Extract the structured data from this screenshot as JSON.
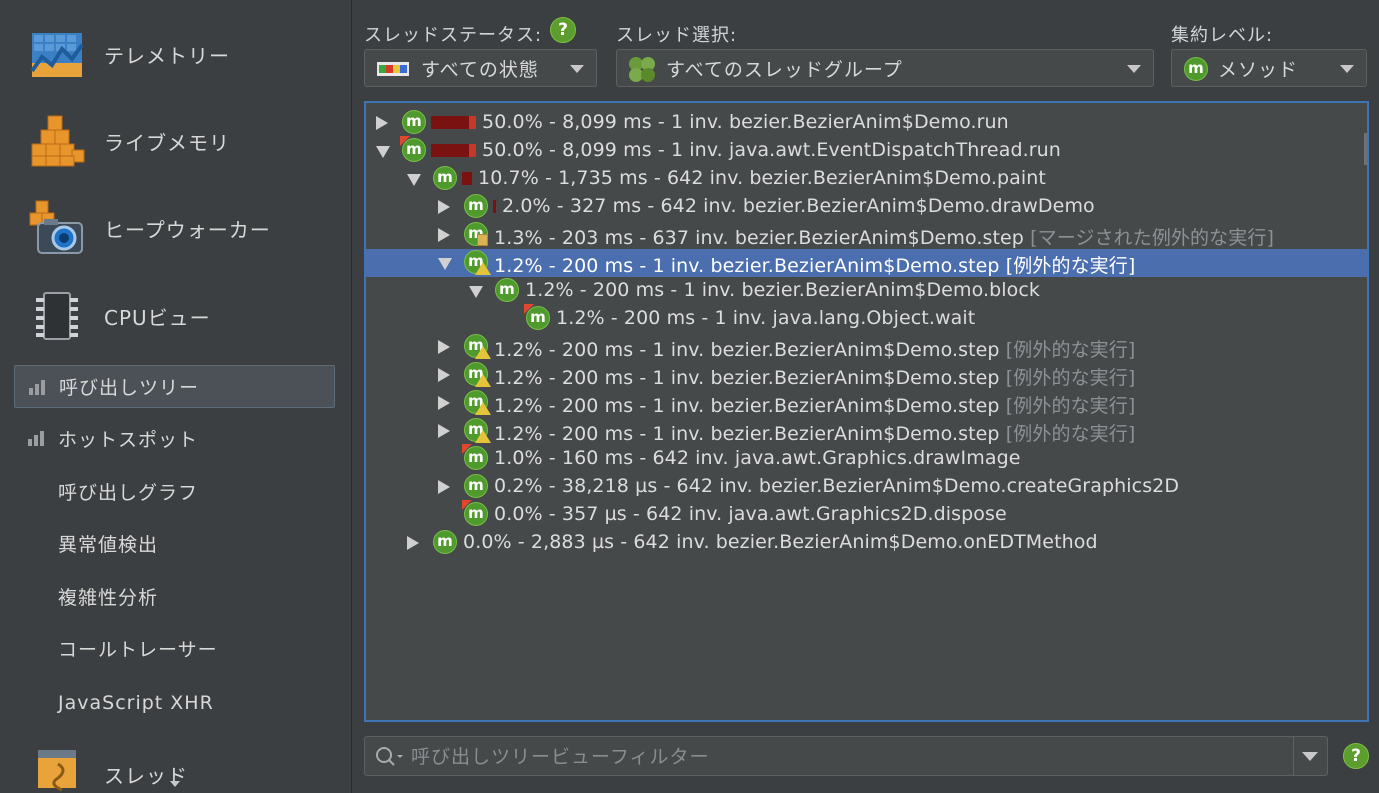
{
  "sidebar": {
    "big_items": [
      {
        "label": "テレメトリー",
        "icon": "telemetry-icon"
      },
      {
        "label": "ライブメモリ",
        "icon": "live-memory-icon"
      },
      {
        "label": "ヒープウォーカー",
        "icon": "heap-walker-icon"
      },
      {
        "label": "CPUビュー",
        "icon": "cpu-views-icon"
      }
    ],
    "sub_items": [
      {
        "label": "呼び出しツリー",
        "selected": true,
        "has_icon": true
      },
      {
        "label": "ホットスポット",
        "selected": false,
        "has_icon": true
      },
      {
        "label": "呼び出しグラフ",
        "selected": false,
        "has_icon": false
      },
      {
        "label": "異常値検出",
        "selected": false,
        "has_icon": false
      },
      {
        "label": "複雑性分析",
        "selected": false,
        "has_icon": false
      },
      {
        "label": "コールトレーサー",
        "selected": false,
        "has_icon": false
      },
      {
        "label": "JavaScript XHR",
        "selected": false,
        "has_icon": false
      }
    ],
    "partial_item": {
      "label": "スレッド",
      "icon": "threads-icon"
    }
  },
  "toolbar": {
    "thread_status_label": "スレッドステータス:",
    "thread_status_value": "すべての状態",
    "thread_select_label": "スレッド選択:",
    "thread_select_value": "すべてのスレッドグループ",
    "aggregation_label": "集約レベル:",
    "aggregation_value": "メソッド",
    "help_glyph": "?"
  },
  "tree": {
    "icon_letter": "m",
    "rows": [
      {
        "depth": 0,
        "toggle": "collapsed",
        "icon": "method",
        "badge": "none",
        "bar": [
          0.5,
          "#7a1212",
          "#c33a2b"
        ],
        "text": "50.0% - 8,099 ms - 1 inv. bezier.BezierAnim$Demo.run",
        "suffix": ""
      },
      {
        "depth": 0,
        "toggle": "expanded",
        "icon": "method",
        "badge": "corner",
        "bar": [
          0.5,
          "#7a1212",
          "#c33a2b"
        ],
        "text": "50.0% - 8,099 ms - 1 inv. java.awt.EventDispatchThread.run",
        "suffix": ""
      },
      {
        "depth": 1,
        "toggle": "expanded",
        "icon": "method",
        "badge": "none",
        "bar": [
          0.107,
          "#7a1212",
          "#7a1212"
        ],
        "text": "10.7% - 1,735 ms - 642 inv. bezier.BezierAnim$Demo.paint",
        "suffix": ""
      },
      {
        "depth": 2,
        "toggle": "collapsed",
        "icon": "method",
        "badge": "none",
        "bar": [
          0.02,
          "#7a1212",
          "#7a1212"
        ],
        "text": "2.0% - 327 ms - 642 inv. bezier.BezierAnim$Demo.drawDemo",
        "suffix": ""
      },
      {
        "depth": 2,
        "toggle": "collapsed",
        "icon": "method",
        "badge": "note",
        "bar": null,
        "text": "1.3% - 203 ms - 637 inv. bezier.BezierAnim$Demo.step",
        "suffix": "[マージされた例外的な実行]"
      },
      {
        "depth": 2,
        "toggle": "expanded",
        "icon": "method",
        "badge": "warn",
        "bar": null,
        "text": "1.2% - 200 ms - 1 inv. bezier.BezierAnim$Demo.step",
        "suffix": "[例外的な実行]",
        "selected": true
      },
      {
        "depth": 3,
        "toggle": "expanded",
        "icon": "method",
        "badge": "none",
        "bar": null,
        "text": "1.2% - 200 ms - 1 inv. bezier.BezierAnim$Demo.block",
        "suffix": ""
      },
      {
        "depth": 4,
        "toggle": "none",
        "icon": "method",
        "badge": "corner",
        "bar": null,
        "text": "1.2% - 200 ms - 1 inv. java.lang.Object.wait",
        "suffix": ""
      },
      {
        "depth": 2,
        "toggle": "collapsed",
        "icon": "method",
        "badge": "warn",
        "bar": null,
        "text": "1.2% - 200 ms - 1 inv. bezier.BezierAnim$Demo.step",
        "suffix": "[例外的な実行]"
      },
      {
        "depth": 2,
        "toggle": "collapsed",
        "icon": "method",
        "badge": "warn",
        "bar": null,
        "text": "1.2% - 200 ms - 1 inv. bezier.BezierAnim$Demo.step",
        "suffix": "[例外的な実行]"
      },
      {
        "depth": 2,
        "toggle": "collapsed",
        "icon": "method",
        "badge": "warn",
        "bar": null,
        "text": "1.2% - 200 ms - 1 inv. bezier.BezierAnim$Demo.step",
        "suffix": "[例外的な実行]"
      },
      {
        "depth": 2,
        "toggle": "collapsed",
        "icon": "method",
        "badge": "warn",
        "bar": null,
        "text": "1.2% - 200 ms - 1 inv. bezier.BezierAnim$Demo.step",
        "suffix": "[例外的な実行]"
      },
      {
        "depth": 2,
        "toggle": "none",
        "icon": "method",
        "badge": "corner",
        "bar": null,
        "text": "1.0% - 160 ms - 642 inv. java.awt.Graphics.drawImage",
        "suffix": ""
      },
      {
        "depth": 2,
        "toggle": "collapsed",
        "icon": "method",
        "badge": "none",
        "bar": null,
        "text": "0.2% - 38,218 µs - 642 inv. bezier.BezierAnim$Demo.createGraphics2D",
        "suffix": ""
      },
      {
        "depth": 2,
        "toggle": "none",
        "icon": "method",
        "badge": "corner",
        "bar": null,
        "text": "0.0% - 357 µs - 642 inv. java.awt.Graphics2D.dispose",
        "suffix": ""
      },
      {
        "depth": 1,
        "toggle": "collapsed",
        "icon": "method",
        "badge": "none",
        "bar": null,
        "text": "0.0% - 2,883 µs - 642 inv. bezier.BezierAnim$Demo.onEDTMethod",
        "suffix": ""
      }
    ]
  },
  "filter": {
    "placeholder": "呼び出しツリービューフィルター",
    "value": ""
  },
  "colors": {
    "accent": "#3f75b3",
    "selection": "#4b6eaf",
    "method_icon": "#4f9a2c",
    "warning": "#e3c43a"
  }
}
